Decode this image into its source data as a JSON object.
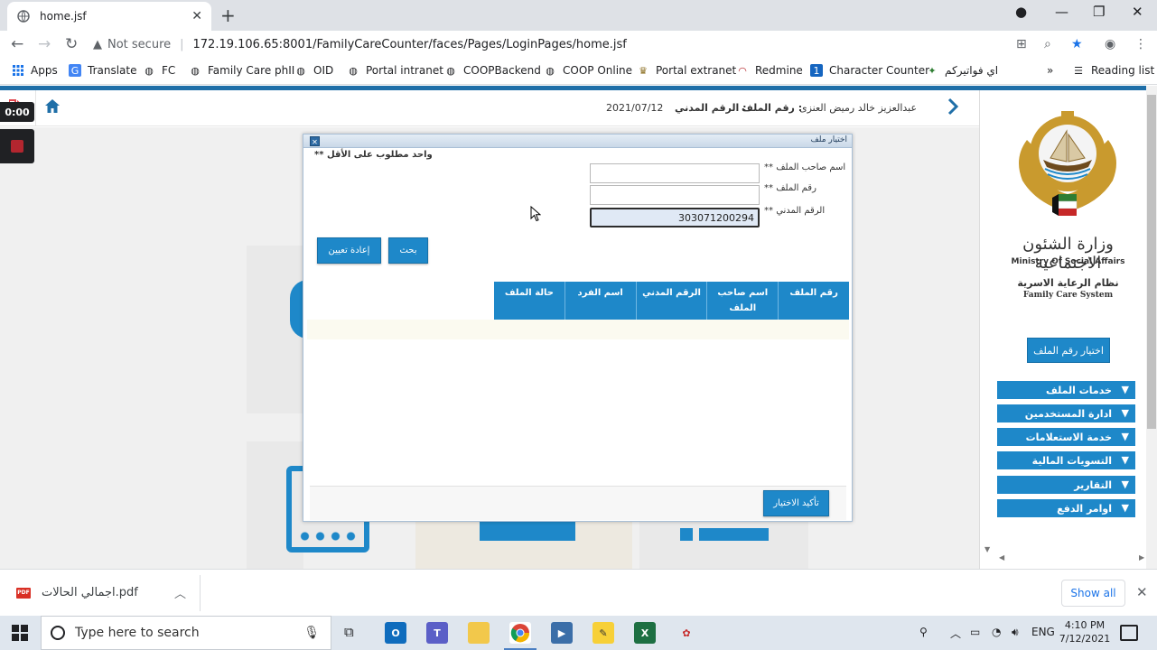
{
  "browser": {
    "tab_title": "home.jsf",
    "not_secure": "Not secure",
    "url": "172.19.106.65:8001/FamilyCareCounter/faces/Pages/LoginPages/home.jsf",
    "bookmarks": [
      {
        "label": "Apps"
      },
      {
        "label": "Translate"
      },
      {
        "label": "FC"
      },
      {
        "label": "Family Care phII"
      },
      {
        "label": "OID"
      },
      {
        "label": "Portal intranet"
      },
      {
        "label": "COOPBackend"
      },
      {
        "label": "COOP Online"
      },
      {
        "label": "Portal extranet"
      },
      {
        "label": "Redmine"
      },
      {
        "label": "Character Counter"
      },
      {
        "label": "اي فواتيركم"
      }
    ],
    "overflow": "»",
    "reading_list": "Reading list"
  },
  "header": {
    "date": "2021/07/12",
    "civil_label": "الرقم المدني :",
    "file_label": "رقم الملف :",
    "user_name": "عبدالعزيز خالد رميض العنزى"
  },
  "recorder": {
    "time": "0:00"
  },
  "sidebar": {
    "ministry_ar": "وزارة الشئون الاجتماعية",
    "ministry_en": "Ministry Of Social Affairs",
    "system_ar": "نظام الرعاية الاسرية",
    "system_en": "Family Care System",
    "select_file_button": "اختيار رقم الملف",
    "menu": [
      {
        "label": "خدمات الملف"
      },
      {
        "label": "ادارة المستخدمين"
      },
      {
        "label": "خدمة الاستعلامات"
      },
      {
        "label": "التسويات المالية"
      },
      {
        "label": "التقارير"
      },
      {
        "label": "اوامر الدفع"
      }
    ]
  },
  "dialog": {
    "title": "اختيار ملف",
    "required_note": "** واحد مطلوب على الأقل",
    "owner_name_label": "** اسم صاحب الملف",
    "file_no_label": "** رقم الملف",
    "civil_id_label": "** الرقم المدني",
    "owner_name_value": "",
    "file_no_value": "",
    "civil_id_value": "303071200294",
    "search_button": "بحث",
    "reset_button": "إعادة تعيين",
    "grid_columns": [
      "رقم الملف",
      "اسم صاحب الملف",
      "الرقم المدني",
      "اسم الفرد",
      "حالة الملف"
    ],
    "confirm_button": "تأكيد الاختيار"
  },
  "downloads": {
    "file_type": "PDF",
    "file_name": "اجمالي الحالات.pdf",
    "show_all": "Show all"
  },
  "taskbar": {
    "search_placeholder": "Type here to search",
    "language": "ENG",
    "time": "4:10 PM",
    "date": "7/12/2021"
  },
  "colors": {
    "brand_blue": "#1e88c9",
    "page_topline": "#1f6fa8",
    "logout_red": "#e0464e"
  }
}
